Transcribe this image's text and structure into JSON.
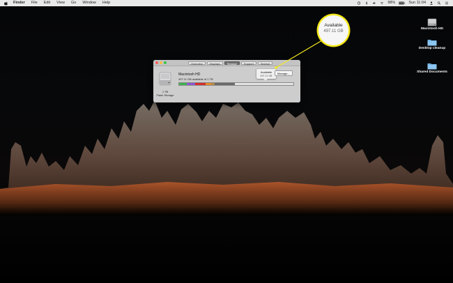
{
  "menubar": {
    "apple_icon": "apple-icon",
    "items": [
      "Finder",
      "File",
      "Edit",
      "View",
      "Go",
      "Window",
      "Help"
    ],
    "status_icons": [
      "time-machine-icon",
      "bluetooth-icon",
      "volume-icon",
      "wifi-icon"
    ],
    "battery": "98%",
    "clock": "Sun 11:04",
    "user_icon": "user-icon",
    "spotlight_icon": "search-icon",
    "notification_icon": "list-icon"
  },
  "desktop": {
    "icons": [
      {
        "label": "Macintosh HD",
        "icon": "hard-drive-icon"
      },
      {
        "label": "Desktop cleanup",
        "icon": "folder-icon"
      },
      {
        "label": "Shared Documents",
        "icon": "folder-icon"
      }
    ]
  },
  "window": {
    "tabs": [
      "Overview",
      "Displays",
      "Storage",
      "Support",
      "Service"
    ],
    "active_tab": "Storage",
    "volume_name": "Macintosh HD",
    "volume_summary": "497.11 GB available of 1 TB",
    "drive_size": "1 TB",
    "drive_type": "Flash Storage",
    "manage_label": "Manage...",
    "tooltip_title": "Available",
    "tooltip_value": "497.11 GB",
    "storage_segments": [
      {
        "color": "#3fb34f",
        "fraction": 0.07
      },
      {
        "color": "#8e5ad1",
        "fraction": 0.07
      },
      {
        "color": "#d62d2d",
        "fraction": 0.09
      },
      {
        "color": "#e58d2b",
        "fraction": 0.05
      },
      {
        "color": "#b78a4a",
        "fraction": 0.03
      },
      {
        "color": "#6a6a6a",
        "fraction": 0.18
      },
      {
        "color": "#e4e4e4",
        "fraction": 0.51
      }
    ]
  },
  "callout": {
    "title": "Available",
    "value": "497.11 GB",
    "accent_color": "#f5ea1a"
  }
}
